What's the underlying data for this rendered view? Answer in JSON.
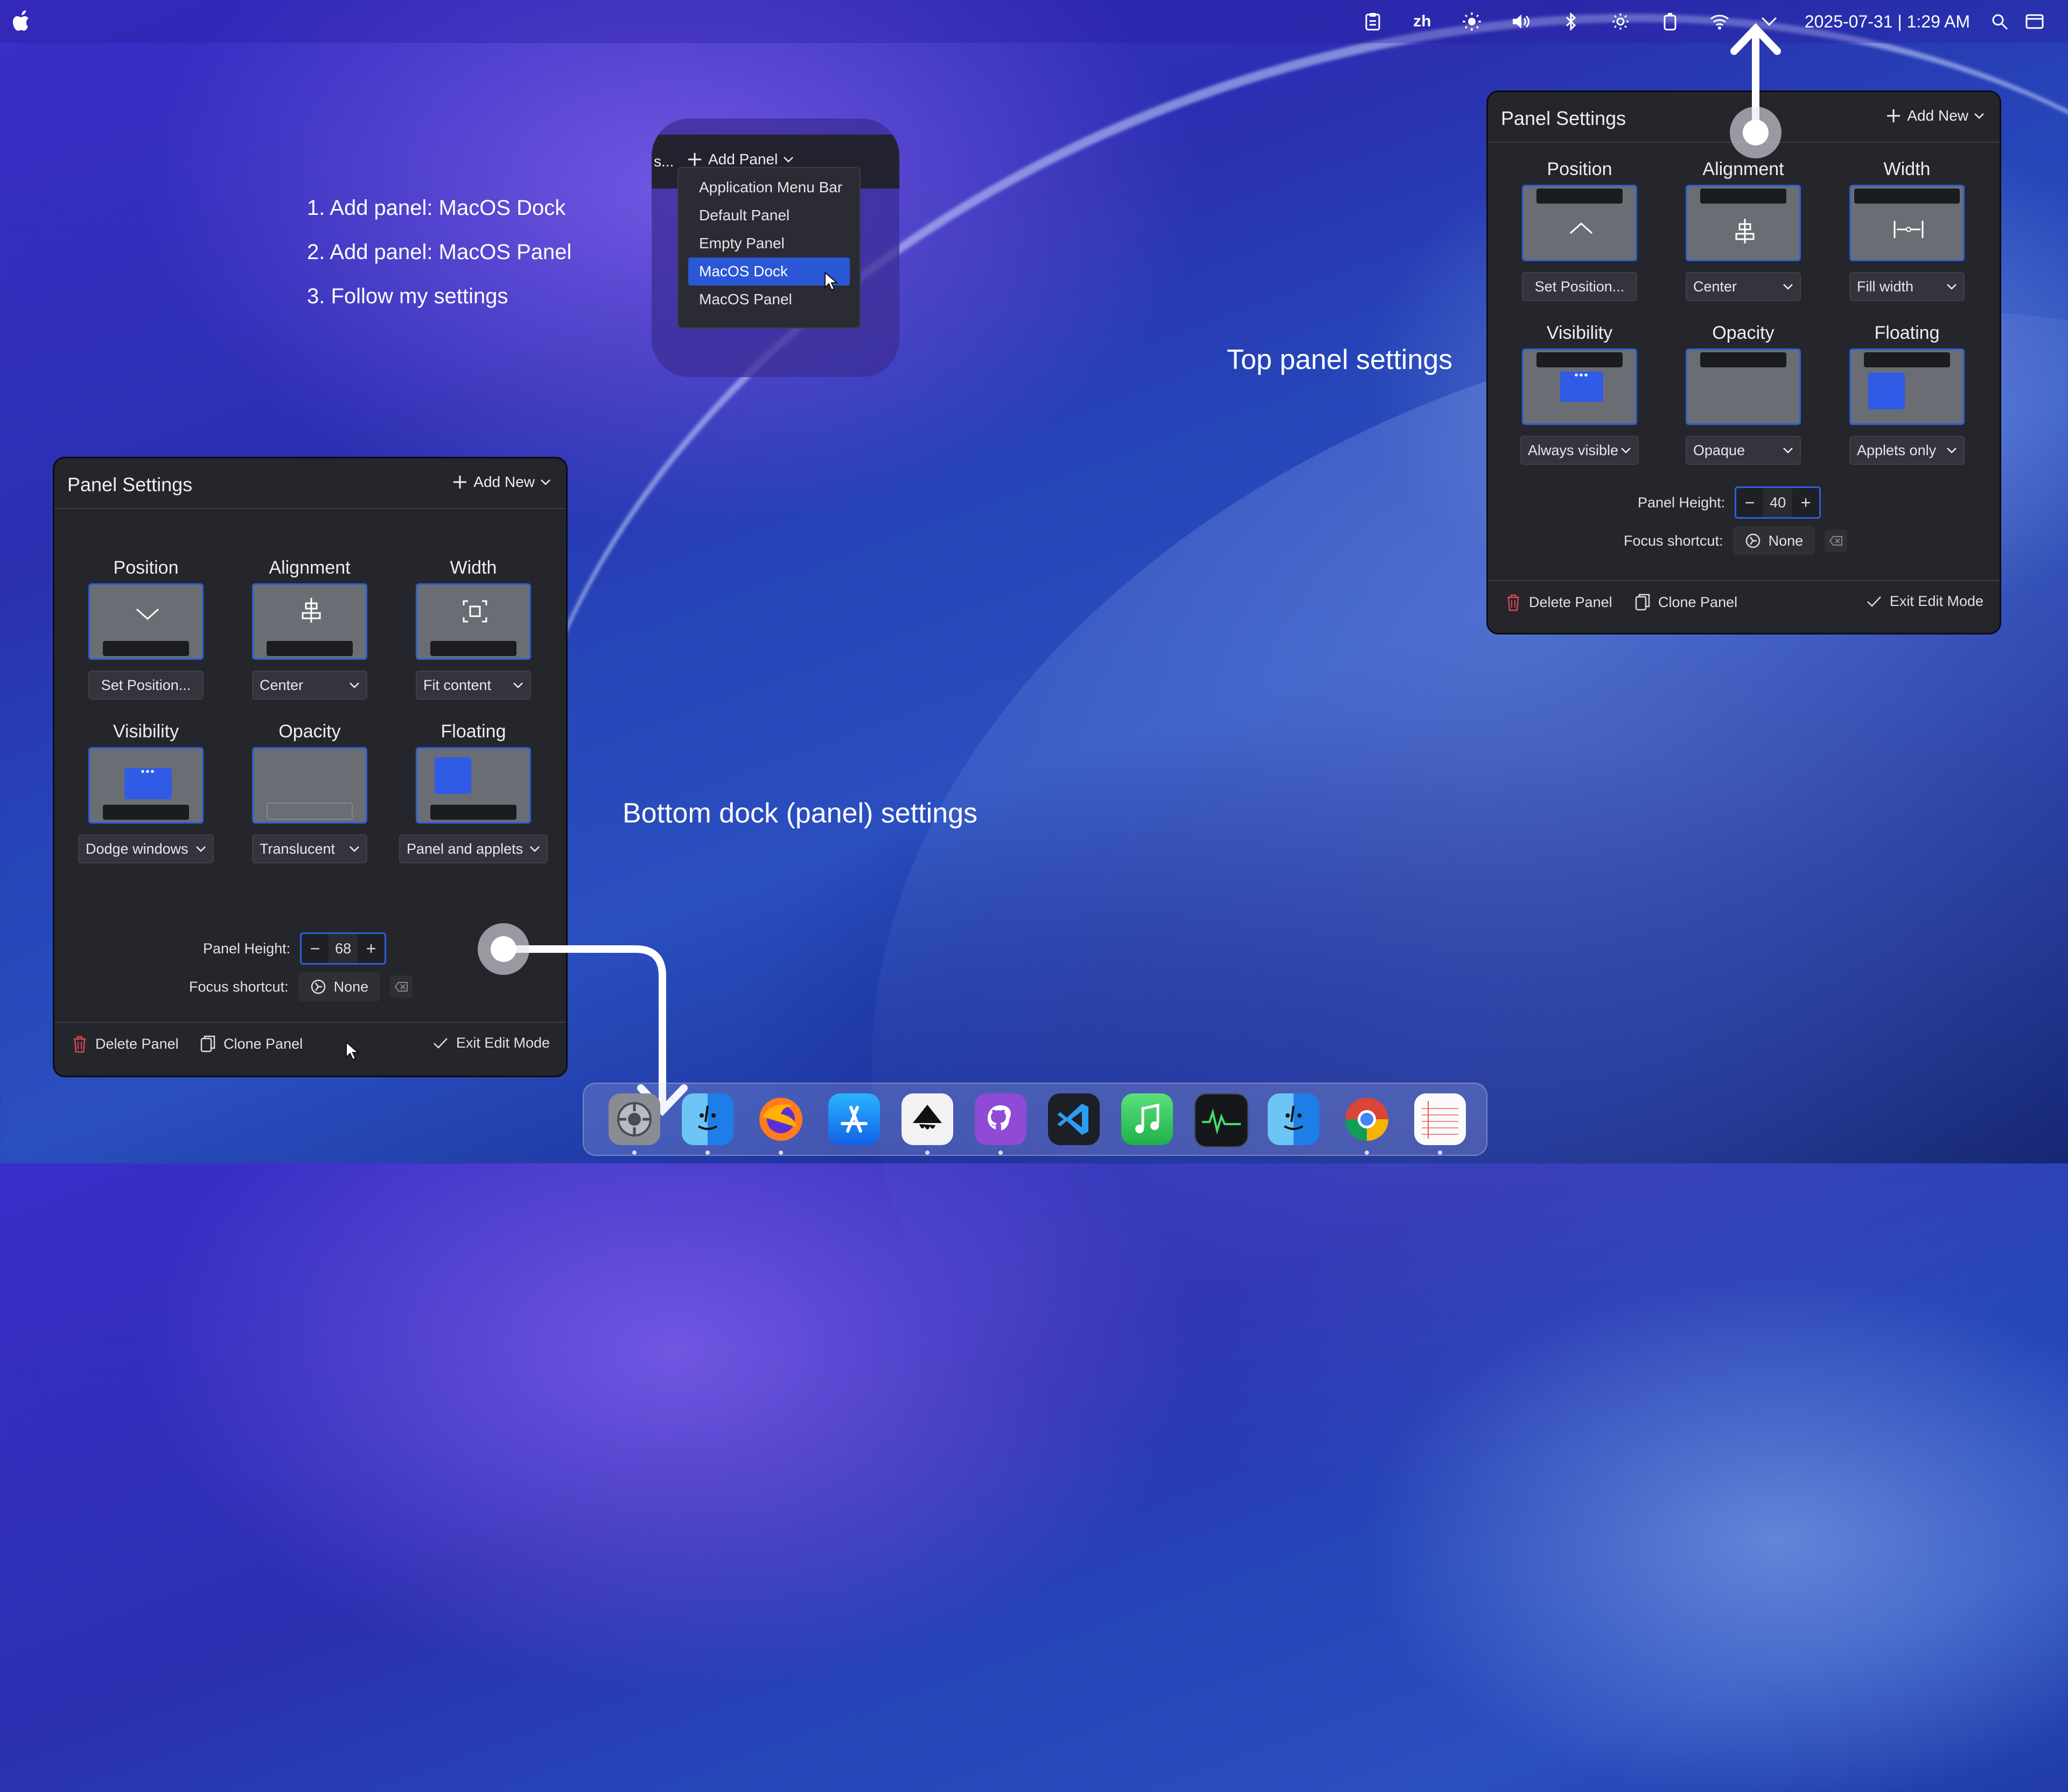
{
  "menubar": {
    "apple_icon": "apple-icon",
    "tray": [
      "clipboard-icon",
      "zh",
      "brightness-icon",
      "volume-icon",
      "bluetooth-icon",
      "night-light-icon",
      "battery-icon",
      "wifi-icon",
      "chevron-down-icon"
    ],
    "input_method": "zh",
    "clock": "2025-07-31 | 1:29 AM"
  },
  "instructions": {
    "step1": "1. Add panel: MacOS Dock",
    "step2": "2. Add panel: MacOS Panel",
    "step3": "3. Follow my settings"
  },
  "captions": {
    "top": "Top panel settings",
    "bottom": "Bottom dock (panel) settings"
  },
  "add_panel": {
    "truncated": "s...",
    "button": "Add Panel",
    "items": [
      "Application Menu Bar",
      "Default Panel",
      "Empty Panel",
      "MacOS Dock",
      "MacOS Panel"
    ],
    "selected": "MacOS Dock"
  },
  "top_panel": {
    "title": "Panel Settings",
    "add_new": "Add New",
    "position_label": "Position",
    "alignment_label": "Alignment",
    "width_label": "Width",
    "position_value": "Set Position...",
    "alignment_value": "Center",
    "width_value": "Fill width",
    "visibility_label": "Visibility",
    "opacity_label": "Opacity",
    "floating_label": "Floating",
    "visibility_value": "Always visible",
    "opacity_value": "Opaque",
    "floating_value": "Applets only",
    "height_label": "Panel Height:",
    "height_value": "40",
    "shortcut_label": "Focus shortcut:",
    "shortcut_value": "None",
    "delete": "Delete Panel",
    "clone": "Clone Panel",
    "exit": "Exit Edit Mode"
  },
  "bottom_panel": {
    "title": "Panel Settings",
    "add_new": "Add New",
    "position_label": "Position",
    "alignment_label": "Alignment",
    "width_label": "Width",
    "position_value": "Set Position...",
    "alignment_value": "Center",
    "width_value": "Fit content",
    "visibility_label": "Visibility",
    "opacity_label": "Opacity",
    "floating_label": "Floating",
    "visibility_value": "Dodge windows",
    "opacity_value": "Translucent",
    "floating_value": "Panel and applets",
    "height_label": "Panel Height:",
    "height_value": "68",
    "shortcut_label": "Focus shortcut:",
    "shortcut_value": "None",
    "delete": "Delete Panel",
    "clone": "Clone Panel",
    "exit": "Exit Edit Mode"
  },
  "dock": {
    "apps": [
      "system-settings-icon",
      "finder-icon",
      "firefox-icon",
      "app-store-icon",
      "inkscape-icon",
      "github-icon",
      "vscode-icon",
      "music-icon",
      "activity-monitor-icon",
      "finder-alt-icon",
      "chrome-icon",
      "textedit-icon"
    ]
  },
  "colors": {
    "accent": "#2d5fd8",
    "panel_bg": "#25262c",
    "selected_menu": "#2a57d6",
    "delete_red": "#e0454f"
  }
}
